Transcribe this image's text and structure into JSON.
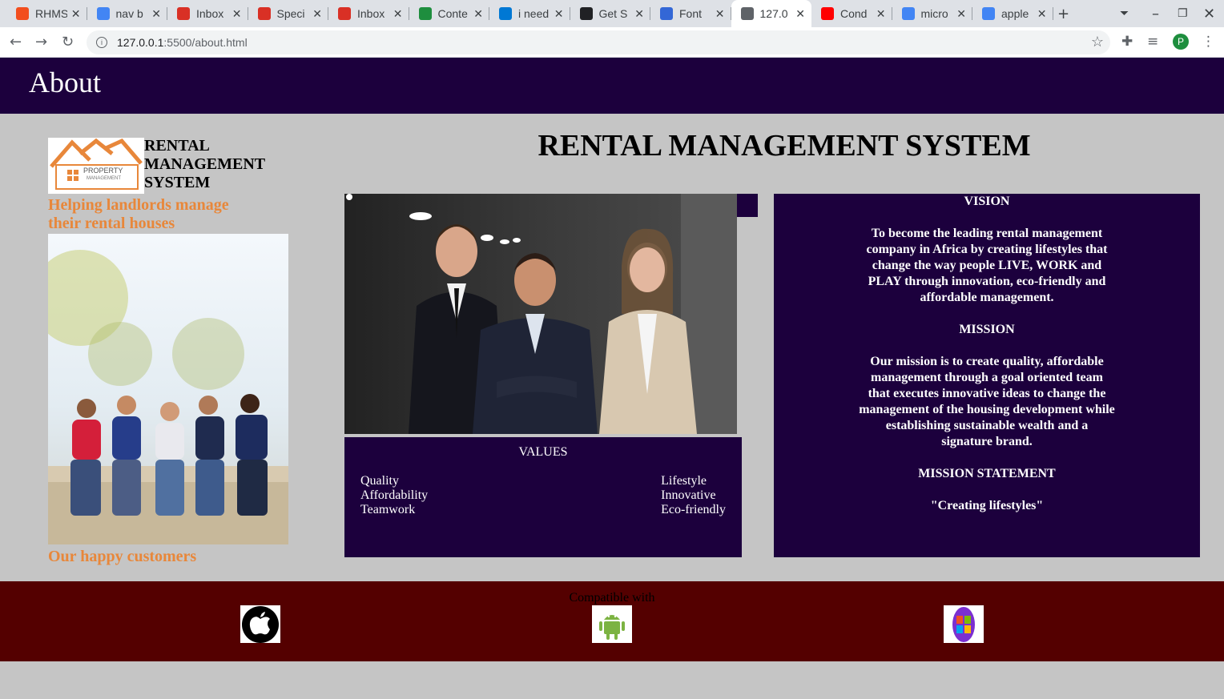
{
  "browser": {
    "tabs": [
      {
        "title": "RHMS",
        "favicon": "figma-icon",
        "color": "#f24e1e"
      },
      {
        "title": "nav b",
        "favicon": "google-icon",
        "color": "#4285f4"
      },
      {
        "title": "Inbox",
        "favicon": "gmail-icon",
        "color": "#d93025"
      },
      {
        "title": "Speci",
        "favicon": "gmail-icon",
        "color": "#d93025"
      },
      {
        "title": "Inbox",
        "favicon": "gmail-icon",
        "color": "#d93025"
      },
      {
        "title": "Conte",
        "favicon": "link-icon",
        "color": "#1e8e3e"
      },
      {
        "title": "i need",
        "favicon": "yammer-icon",
        "color": "#0078d4"
      },
      {
        "title": "Get S",
        "favicon": "app-icon",
        "color": "#202124"
      },
      {
        "title": "Font",
        "favicon": "flag-icon",
        "color": "#3367d6"
      },
      {
        "title": "127.0",
        "favicon": "globe-icon",
        "color": "#5f6368",
        "active": true
      },
      {
        "title": "Cond",
        "favicon": "youtube-icon",
        "color": "#ff0000"
      },
      {
        "title": "micro",
        "favicon": "google-icon",
        "color": "#4285f4"
      },
      {
        "title": "apple",
        "favicon": "google-icon",
        "color": "#4285f4"
      }
    ],
    "new_tab": "+",
    "url_host": "127.0.0.1",
    "url_path": ":5500/about.html",
    "profile_initial": "P"
  },
  "page": {
    "header_title": "About",
    "brand_name": [
      "RENTAL",
      "MANAGEMENT",
      "SYSTEM"
    ],
    "logo_text_1": "PROPERTY",
    "logo_text_2": "MANAGEMENT",
    "tagline": "Helping landlords manage their rental houses",
    "customers_caption": "Our happy customers",
    "main_title": "RENTAL MANAGEMENT SYSTEM",
    "values": {
      "title": "VALUES",
      "left": [
        "Quality",
        "Affordability",
        "Teamwork"
      ],
      "right": [
        "Lifestyle",
        "Innovative",
        "Eco-friendly"
      ]
    },
    "vision": {
      "vision_title": "VISION",
      "vision_text": "To become the leading rental management company in Africa by creating lifestyles that change the way people LIVE, WORK and PLAY through innovation, eco-friendly and affordable management.",
      "mission_title": "MISSION",
      "mission_text": "Our mission is to create quality, affordable management through a goal oriented team that executes innovative ideas to change the management of the housing development while establishing sustainable wealth and a signature brand.",
      "statement_title": "MISSION STATEMENT",
      "statement_text": "\"Creating lifestyles\""
    },
    "footer": {
      "compatible_label": "Compatible with",
      "platforms": [
        "apple-icon",
        "android-icon",
        "windows-icon"
      ]
    }
  },
  "colors": {
    "header_bg": "#1c003d",
    "accent_orange": "#e8873a",
    "footer_bg": "#540000",
    "page_bg": "#c5c5c5"
  }
}
